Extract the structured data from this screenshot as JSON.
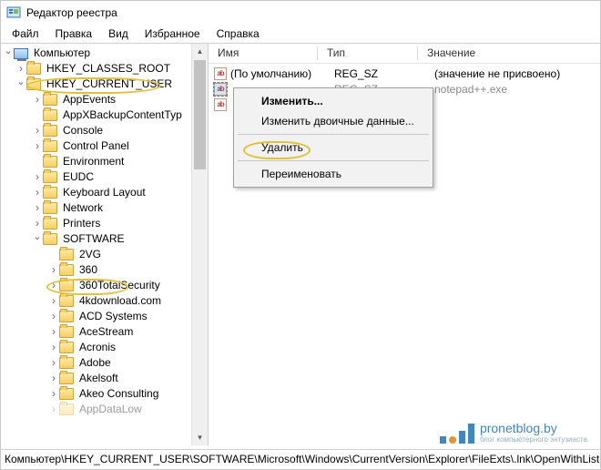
{
  "window": {
    "title": "Редактор реестра"
  },
  "menu": {
    "file": "Файл",
    "edit": "Правка",
    "view": "Вид",
    "fav": "Избранное",
    "help": "Справка"
  },
  "tree": {
    "root": "Компьютер",
    "items": [
      "HKEY_CLASSES_ROOT",
      "HKEY_CURRENT_USER",
      "AppEvents",
      "AppXBackupContentTyp",
      "Console",
      "Control Panel",
      "Environment",
      "EUDC",
      "Keyboard Layout",
      "Network",
      "Printers",
      "SOFTWARE",
      "2VG",
      "360",
      "360TotalSecurity",
      "4kdownload.com",
      "ACD Systems",
      "AceStream",
      "Acronis",
      "Adobe",
      "Akelsoft",
      "Akeo Consulting",
      "AppDataLow"
    ]
  },
  "list": {
    "cols": {
      "name": "Имя",
      "type": "Тип",
      "value": "Значение"
    },
    "rows": [
      {
        "name": "(По умолчанию)",
        "type": "REG_SZ",
        "value": "(значение не присвоено)"
      },
      {
        "name": "",
        "type": "REG_SZ",
        "value": "notepad++.exe"
      }
    ]
  },
  "context": {
    "modify": "Изменить...",
    "modify_bin": "Изменить двоичные данные...",
    "delete": "Удалить",
    "rename": "Переименовать"
  },
  "status": "Компьютер\\HKEY_CURRENT_USER\\SOFTWARE\\Microsoft\\Windows\\CurrentVersion\\Explorer\\FileExts\\.lnk\\OpenWithList",
  "watermark": {
    "brand": "pronetblog.by",
    "tag": "блог компьютерного энтузиаста"
  }
}
